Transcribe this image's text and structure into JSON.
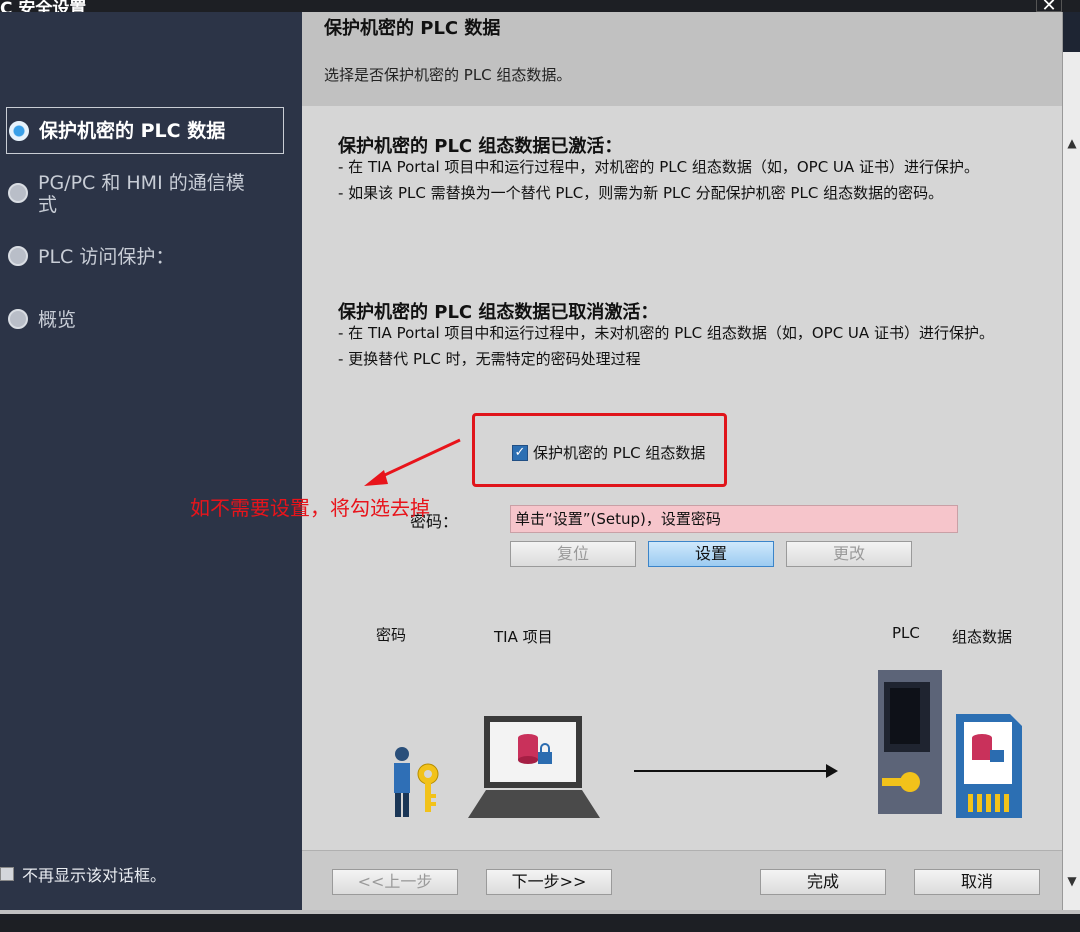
{
  "window": {
    "title": "C 安全设置",
    "close_glyph": "✕"
  },
  "sidebar": {
    "items": [
      {
        "label": "保护机密的 PLC 数据",
        "active": true
      },
      {
        "label": "PG/PC 和 HMI 的通信模式",
        "active": false
      },
      {
        "label": "PLC 访问保护：",
        "active": false
      },
      {
        "label": "概览",
        "active": false
      }
    ],
    "dont_show": "不再显示该对话框。"
  },
  "header": {
    "title": "保护机密的 PLC 数据",
    "subtitle": "选择是否保护机密的 PLC 组态数据。"
  },
  "sections": [
    {
      "title": "保护机密的 PLC 组态数据已激活：",
      "lines": [
        "- 在 TIA Portal 项目中和运行过程中，对机密的 PLC 组态数据（如，OPC UA 证书）进行保护。",
        "- 如果该 PLC 需替换为一个替代 PLC，则需为新 PLC 分配保护机密 PLC 组态数据的密码。"
      ]
    },
    {
      "title": "保护机密的 PLC 组态数据已取消激活：",
      "lines": [
        "- 在 TIA Portal 项目中和运行过程中，未对机密的 PLC 组态数据（如，OPC UA 证书）进行保护。",
        "- 更换替代 PLC 时，无需特定的密码处理过程"
      ]
    }
  ],
  "protect_checkbox": {
    "label": "保护机密的 PLC 组态数据",
    "checked": true
  },
  "password": {
    "label": "密码：",
    "value": "单击“设置”(Setup)，设置密码"
  },
  "buttons": {
    "reset": "复位",
    "setup": "设置",
    "change": "更改"
  },
  "illustration": {
    "password": "密码",
    "tia_project": "TIA 项目",
    "plc": "PLC",
    "config_data": "组态数据"
  },
  "footer": {
    "prev": "<<上一步",
    "next": "下一步>>",
    "finish": "完成",
    "cancel": "取消"
  },
  "annotation": {
    "text": "如不需要设置，将勾选去掉",
    "color": "#e8141b"
  },
  "colors": {
    "sidebar_bg": "#2c3447",
    "accent": "#3aa0e8",
    "password_field_bg": "#f6c5cb"
  }
}
